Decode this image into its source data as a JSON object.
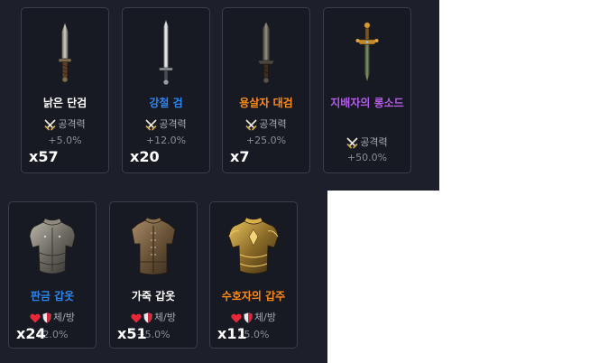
{
  "colors": {
    "common": "#ffffff",
    "rare": "#2d86f0",
    "epic": "#ff8a18",
    "legendary": "#b35ae8",
    "panel": "#1d202b",
    "card": "#171a22"
  },
  "weapons": [
    {
      "name": "낡은 단검",
      "rarity": "common",
      "icon": "dagger-icon",
      "stat_label": "공격력",
      "stat_value": "+5.0%",
      "count": "x57"
    },
    {
      "name": "강철 검",
      "rarity": "rare",
      "icon": "sword-icon",
      "stat_label": "공격력",
      "stat_value": "+12.0%",
      "count": "x20"
    },
    {
      "name": "용살자 대검",
      "rarity": "epic",
      "icon": "greatsword-icon",
      "stat_label": "공격력",
      "stat_value": "+25.0%",
      "count": "x7"
    },
    {
      "name": "지배자의 롱소드",
      "rarity": "legendary",
      "icon": "longsword-icon",
      "stat_label": "공격력",
      "stat_value": "+50.0%",
      "count": ""
    }
  ],
  "armors": [
    {
      "name": "판금 갑옷",
      "rarity": "rare",
      "icon": "plate-armor-icon",
      "stat_label": "체/방",
      "stat_value": "12.0%",
      "count": "x24"
    },
    {
      "name": "가죽 갑옷",
      "rarity": "common",
      "icon": "leather-armor-icon",
      "stat_label": "체/방",
      "stat_value": "+5.0%",
      "count": "x51"
    },
    {
      "name": "수호자의 갑주",
      "rarity": "epic",
      "icon": "guardian-armor-icon",
      "stat_label": "체/방",
      "stat_value": "25.0%",
      "count": "x11"
    }
  ]
}
